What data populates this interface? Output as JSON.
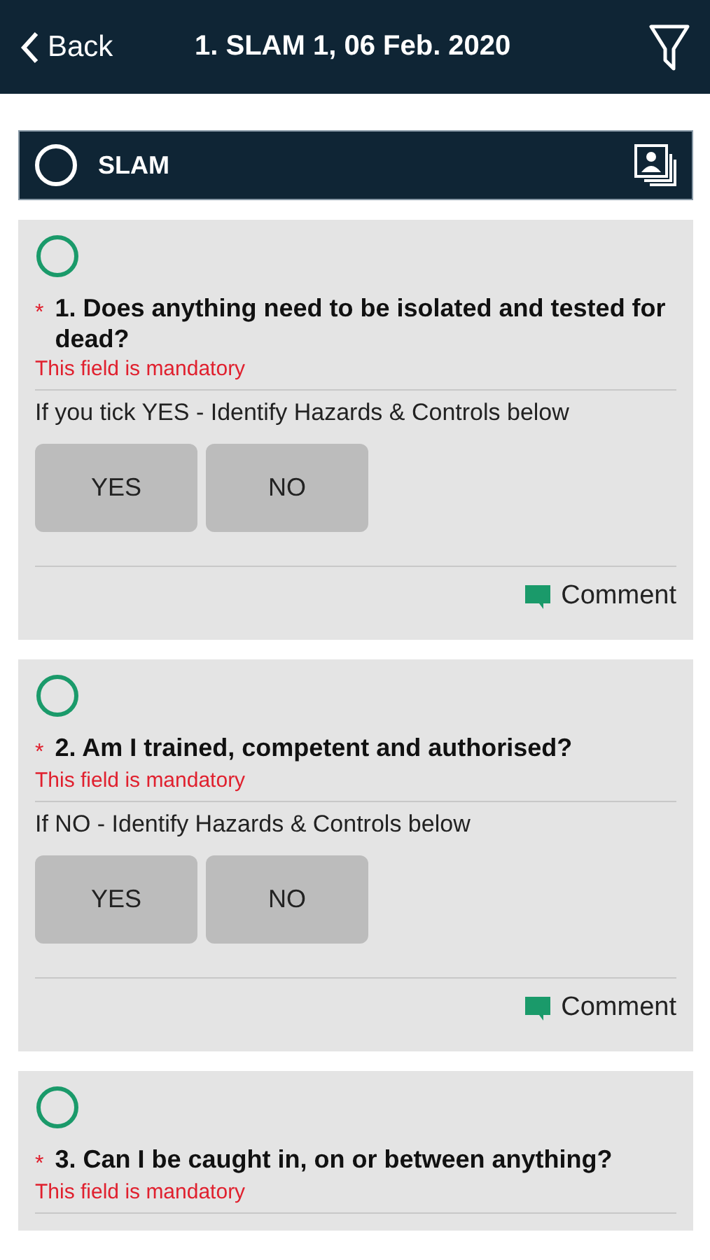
{
  "nav": {
    "back": "Back",
    "title": "1. SLAM 1, 06 Feb. 2020"
  },
  "section": {
    "title": "SLAM",
    "completed": false
  },
  "questions": [
    {
      "completed": false,
      "required": true,
      "required_mark": "*",
      "text": "1. Does anything need to be isolated and tested for dead?",
      "error": "This field is mandatory",
      "hint": "If you tick YES - Identify Hazards & Controls below",
      "options": [
        {
          "label": "YES",
          "selected": false
        },
        {
          "label": "NO",
          "selected": false
        }
      ],
      "comment": "Comment"
    },
    {
      "completed": false,
      "required": true,
      "required_mark": "*",
      "text": "2. Am I trained, competent and authorised?",
      "error": "This field is mandatory",
      "hint": "If NO - Identify Hazards & Controls below",
      "options": [
        {
          "label": "YES",
          "selected": false
        },
        {
          "label": "NO",
          "selected": false
        }
      ],
      "comment": "Comment"
    },
    {
      "completed": false,
      "required": true,
      "required_mark": "*",
      "text": "3. Can I be caught in, on or between anything?",
      "error": "This field is mandatory"
    }
  ]
}
